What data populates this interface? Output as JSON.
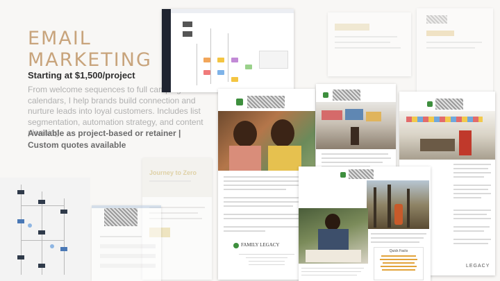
{
  "hero": {
    "title_line1": "EMAIL",
    "title_line2": "MARKETING",
    "price": "Starting at $1,500/project",
    "description": "From welcome sequences to full campaign calendars, I help brands build connection and nurture leads into loyal customers. Includes list segmentation, automation strategy, and content planning.",
    "availability_line1": "Available as project-based or retainer |",
    "availability_line2": "Custom quotes available"
  },
  "samples": {
    "family_legacy": "FAMILY LEGACY",
    "journey_title": "Journey to Zero",
    "facts_heading": "Quick Facts",
    "legacy_badge": "LEGACY"
  },
  "colors": {
    "accent_tan": "#c8a47c",
    "heading_dark": "#2f2f2f",
    "body_grey": "#b0b0b0",
    "brand_green": "#3e8f3e"
  }
}
